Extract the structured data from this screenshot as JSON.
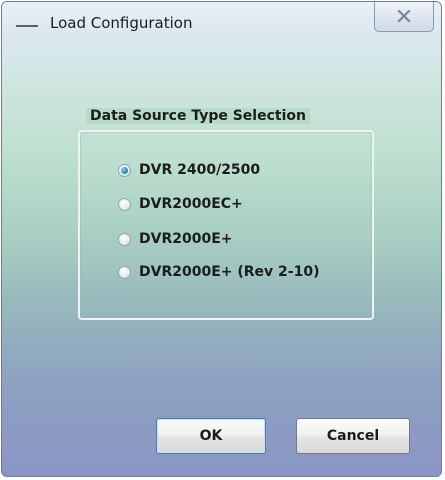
{
  "window": {
    "title": "Load Configuration",
    "icons": {
      "app": "dash-icon",
      "close": "close-icon"
    }
  },
  "group": {
    "title": "Data Source Type Selection",
    "options": [
      {
        "label": "DVR 2400/2500",
        "selected": true
      },
      {
        "label": "DVR2000EC+",
        "selected": false
      },
      {
        "label": "DVR2000E+",
        "selected": false
      },
      {
        "label": "DVR2000E+ (Rev 2-10)",
        "selected": false
      }
    ]
  },
  "buttons": {
    "ok_label": "OK",
    "cancel_label": "Cancel"
  },
  "colors": {
    "accent": "#2d86b6",
    "close_glyph": "#7d8793"
  }
}
